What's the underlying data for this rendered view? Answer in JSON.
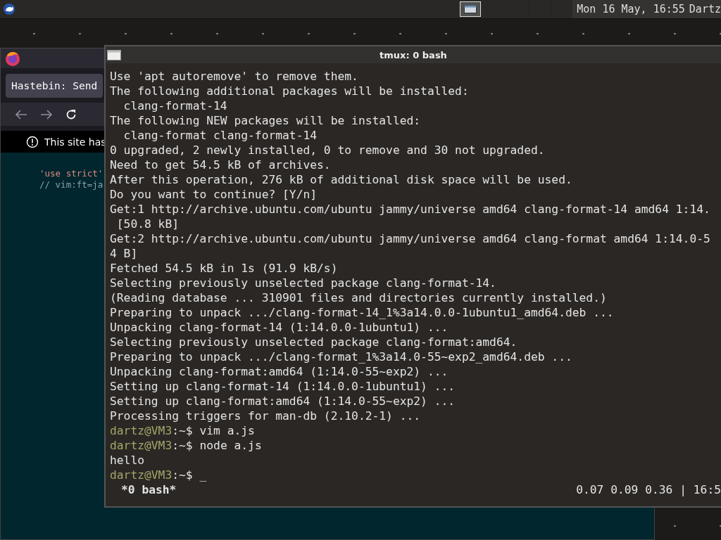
{
  "top_bar": {
    "clock": "Mon 16 May, 16:55",
    "user": "Dartz"
  },
  "browser": {
    "tab": {
      "label": "Hastebin: Send",
      "selected": true
    },
    "notification": "This site has",
    "code_lines": [
      {
        "kind": "string",
        "text": "'use strict'"
      },
      {
        "kind": "comment",
        "text": "// vim:ft=ja"
      }
    ]
  },
  "terminal": {
    "title": "tmux: 0 bash",
    "lines": [
      {
        "kind": "output",
        "text": "Use 'apt autoremove' to remove them."
      },
      {
        "kind": "output",
        "text": "The following additional packages will be installed:"
      },
      {
        "kind": "output",
        "text": "  clang-format-14"
      },
      {
        "kind": "output",
        "text": "The following NEW packages will be installed:"
      },
      {
        "kind": "output",
        "text": "  clang-format clang-format-14"
      },
      {
        "kind": "output",
        "text": "0 upgraded, 2 newly installed, 0 to remove and 30 not upgraded."
      },
      {
        "kind": "output",
        "text": "Need to get 54.5 kB of archives."
      },
      {
        "kind": "output",
        "text": "After this operation, 276 kB of additional disk space will be used."
      },
      {
        "kind": "output",
        "text": "Do you want to continue? [Y/n]"
      },
      {
        "kind": "output",
        "text": "Get:1 http://archive.ubuntu.com/ubuntu jammy/universe amd64 clang-format-14 amd64 1:14."
      },
      {
        "kind": "output",
        "text": " [50.8 kB]"
      },
      {
        "kind": "output",
        "text": "Get:2 http://archive.ubuntu.com/ubuntu jammy/universe amd64 clang-format amd64 1:14.0-5"
      },
      {
        "kind": "output",
        "text": "4 B]"
      },
      {
        "kind": "output",
        "text": "Fetched 54.5 kB in 1s (91.9 kB/s)"
      },
      {
        "kind": "output",
        "text": "Selecting previously unselected package clang-format-14."
      },
      {
        "kind": "output",
        "text": "(Reading database ... 310901 files and directories currently installed.)"
      },
      {
        "kind": "output",
        "text": "Preparing to unpack .../clang-format-14_1%3a14.0.0-1ubuntu1_amd64.deb ..."
      },
      {
        "kind": "output",
        "text": "Unpacking clang-format-14 (1:14.0.0-1ubuntu1) ..."
      },
      {
        "kind": "output",
        "text": "Selecting previously unselected package clang-format:amd64."
      },
      {
        "kind": "output",
        "text": "Preparing to unpack .../clang-format_1%3a14.0-55~exp2_amd64.deb ..."
      },
      {
        "kind": "output",
        "text": "Unpacking clang-format:amd64 (1:14.0-55~exp2) ..."
      },
      {
        "kind": "output",
        "text": "Setting up clang-format-14 (1:14.0.0-1ubuntu1) ..."
      },
      {
        "kind": "output",
        "text": "Setting up clang-format:amd64 (1:14.0-55~exp2) ..."
      },
      {
        "kind": "output",
        "text": "Processing triggers for man-db (2.10.2-1) ..."
      },
      {
        "kind": "prompt",
        "user": "dartz@VM3",
        "path": ":~$",
        "text": "vim a.js"
      },
      {
        "kind": "prompt",
        "user": "dartz@VM3",
        "path": ":~$",
        "text": "node a.js"
      },
      {
        "kind": "output",
        "text": "hello"
      },
      {
        "kind": "prompt",
        "user": "dartz@VM3",
        "path": ":~$",
        "text": "_"
      }
    ],
    "status_left": "*0 bash*",
    "status_right": "0.07 0.09 0.36 | 16:5"
  }
}
